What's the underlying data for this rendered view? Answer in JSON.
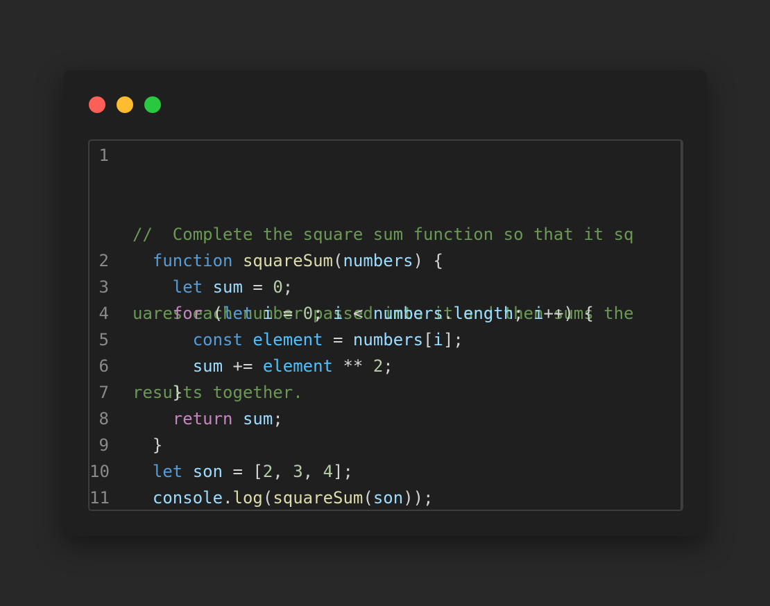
{
  "window": {
    "controls": [
      "close",
      "minimize",
      "maximize"
    ]
  },
  "editor": {
    "line_numbers": [
      "1",
      "2",
      "3",
      "4",
      "5",
      "6",
      "7",
      "8",
      "9",
      "10",
      "11"
    ],
    "comment_lines": [
      "//  Complete the square sum function so that it sq",
      "uares each number passed into it and then sums the",
      "results together."
    ],
    "tokens": {
      "function": "function",
      "squareSum": "squareSum",
      "numbers": "numbers",
      "let": "let",
      "sum": "sum",
      "zero": "0",
      "for": "for",
      "i": "i",
      "length": "length",
      "const": "const",
      "element": "element",
      "two": "2",
      "three": "3",
      "four": "4",
      "return": "return",
      "son": "son",
      "console": "console",
      "log": "log"
    }
  },
  "colors": {
    "background": "#282828",
    "window": "#1f1f1f",
    "comment": "#6a9955",
    "keyword": "#569cd6",
    "control": "#c586c0",
    "function": "#dcdcaa",
    "variable": "#9cdcfe",
    "number": "#b5cea8",
    "dot_red": "#ff5f57",
    "dot_yellow": "#febc2e",
    "dot_green": "#28c840"
  }
}
